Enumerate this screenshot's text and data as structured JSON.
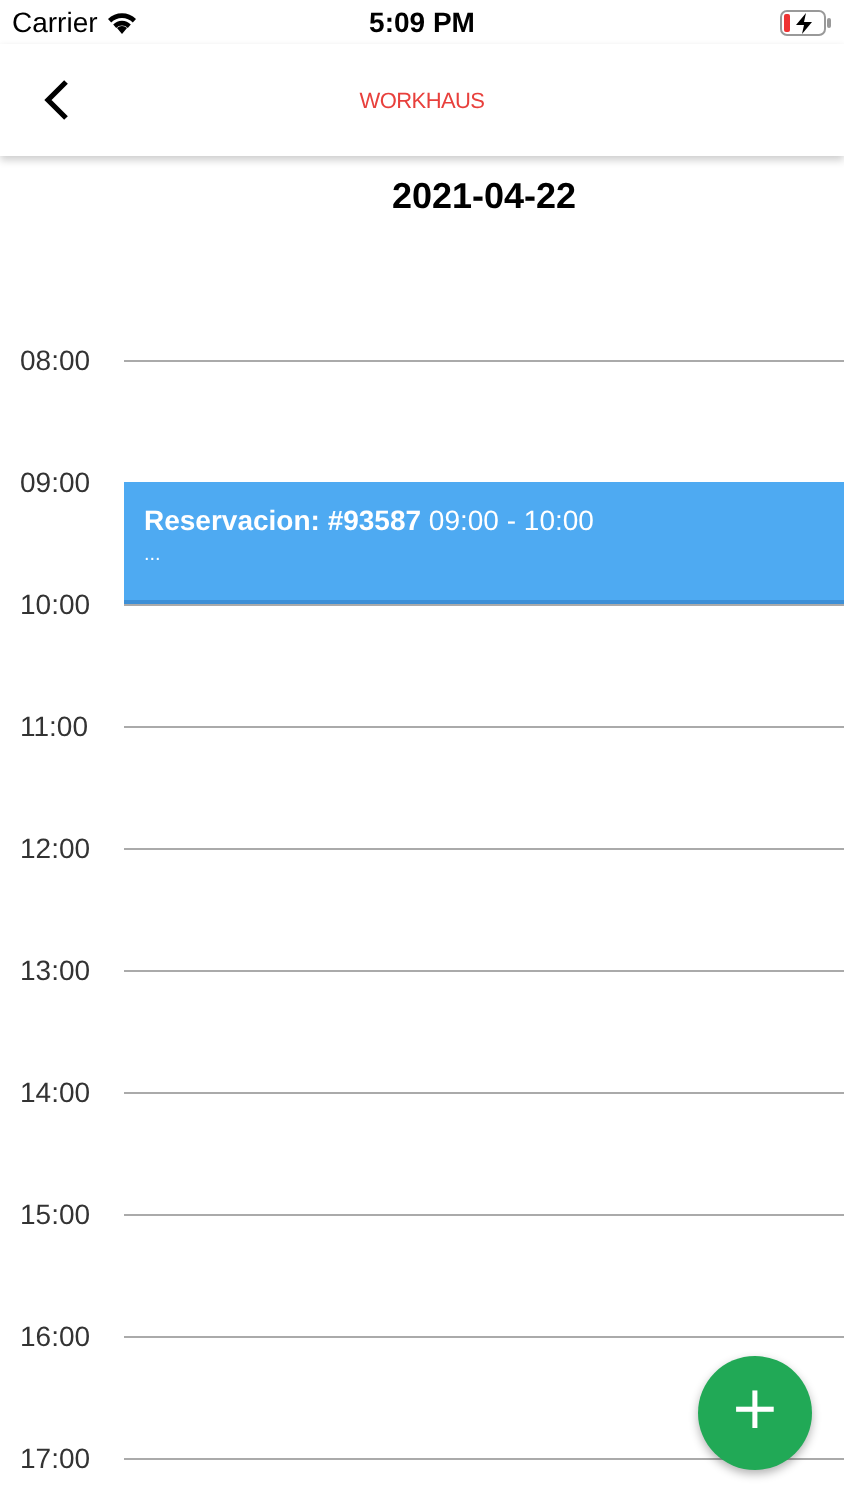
{
  "status_bar": {
    "carrier": "Carrier",
    "time": "5:09 PM"
  },
  "nav_bar": {
    "logo": "WORKHAUS"
  },
  "date": "2021-04-22",
  "hours": [
    {
      "label": "08:00"
    },
    {
      "label": "09:00",
      "events": [
        {
          "title": "**Reservacion: #93587** 09:00 - 10:00",
          "detail": "...",
          "color": "#4eaaf2"
        }
      ]
    },
    {
      "label": "10:00"
    },
    {
      "label": "11:00"
    },
    {
      "label": "12:00"
    },
    {
      "label": "13:00"
    },
    {
      "label": "14:00"
    },
    {
      "label": "15:00"
    },
    {
      "label": "16:00"
    },
    {
      "label": "17:00"
    }
  ],
  "fab": {
    "label": "+"
  }
}
